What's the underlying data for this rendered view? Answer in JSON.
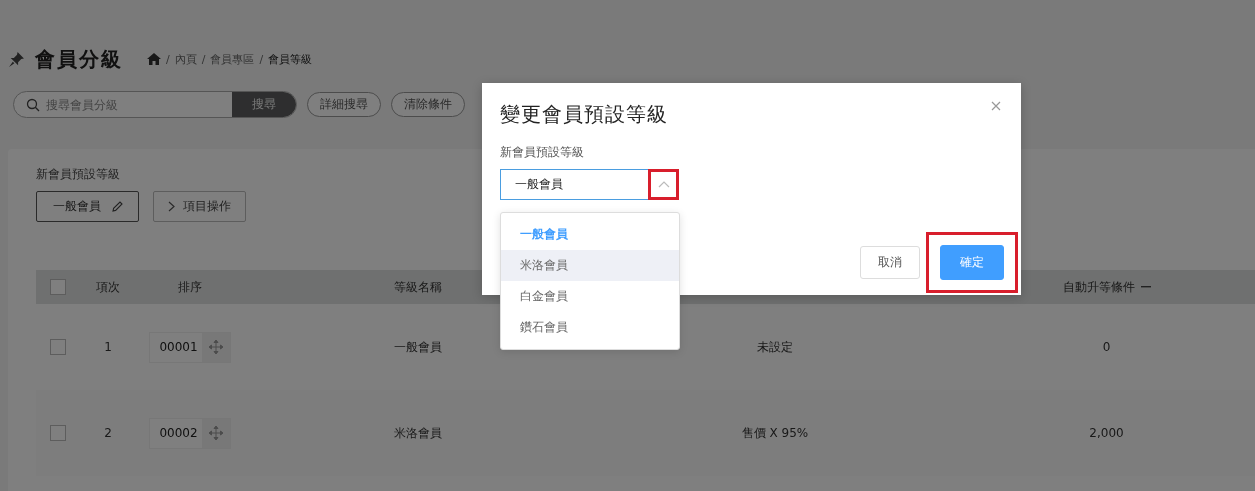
{
  "page": {
    "title": "會員分級",
    "breadcrumb": [
      "內頁",
      "會員專區",
      "會員等級"
    ],
    "breadcrumb_separator": "/"
  },
  "search": {
    "placeholder": "搜尋會員分級",
    "button": "搜尋"
  },
  "filter_buttons": [
    "詳細搜尋",
    "清除條件"
  ],
  "default_level": {
    "label": "新會員預設等級",
    "value": "一般會員",
    "actions_button": "項目操作"
  },
  "table": {
    "columns": [
      {
        "kind": "checkbox",
        "checked": false
      },
      {
        "kind": "text",
        "label": "項次"
      },
      {
        "kind": "text",
        "label": "排序"
      },
      {
        "kind": "text",
        "label": "等級名稱"
      },
      {
        "kind": "covered"
      },
      {
        "kind": "collapsible",
        "label": "自動升等條件"
      }
    ],
    "rows": [
      {
        "checked": false,
        "index": "1",
        "order": "00001",
        "name": "一般會員",
        "column_5": "未設定",
        "auto_upgrade": "0"
      },
      {
        "checked": false,
        "index": "2",
        "order": "00002",
        "name": "米洛會員",
        "column_5": "售價 X 95%",
        "auto_upgrade": "2,000"
      }
    ]
  },
  "dialog": {
    "title": "變更會員預設等級",
    "field_label": "新會員預設等級",
    "select_value": "一般會員",
    "expanded": true,
    "arrow_highlighted": true,
    "options": [
      {
        "label": "一般會員",
        "selected": true,
        "hovered": false
      },
      {
        "label": "米洛會員",
        "selected": false,
        "hovered": true
      },
      {
        "label": "白金會員",
        "selected": false,
        "hovered": false
      },
      {
        "label": "鑽石會員",
        "selected": false,
        "hovered": false
      }
    ],
    "buttons": [
      {
        "label": "取消",
        "kind": "secondary",
        "highlighted": false
      },
      {
        "label": "確定",
        "kind": "primary",
        "highlighted": true
      }
    ]
  }
}
